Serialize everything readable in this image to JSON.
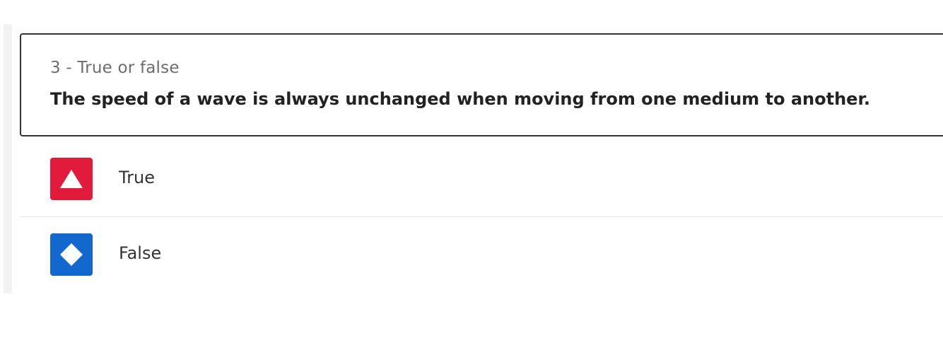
{
  "question": {
    "type_label": "3 - True or false",
    "text": "The speed of a wave is always unchanged when moving from one medium to another."
  },
  "answers": [
    {
      "label": "True",
      "icon": "triangle-icon",
      "color": "#e21b3c"
    },
    {
      "label": "False",
      "icon": "diamond-icon",
      "color": "#1368ce"
    }
  ],
  "colors": {
    "card_border": "#333333",
    "panel_background": "#f2f2f2"
  }
}
